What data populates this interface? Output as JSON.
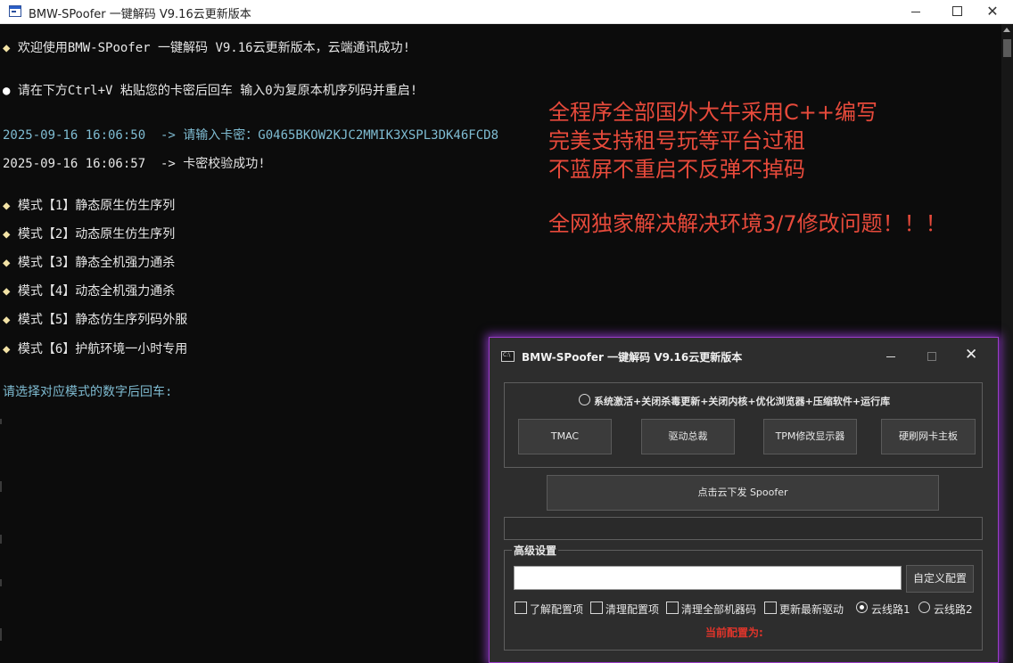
{
  "window": {
    "title": "BMW-SPoofer 一键解码 V9.16云更新版本"
  },
  "console": {
    "lines": [
      {
        "bullet": "◆",
        "text": " 欢迎使用BMW-SPoofer 一键解码 V9.16云更新版本，云端通讯成功!"
      },
      {
        "bullet": "●",
        "text": " 请在下方Ctrl+V 粘贴您的卡密后回车 输入0为复原本机序列码并重启!"
      },
      {
        "text": "2025-09-16 16:06:50  -> 请输入卡密：G0465BKOW2KJC2MMIK3XSPL3DK46FCD8"
      },
      {
        "text": "2025-09-16 16:06:57  -> 卡密校验成功!"
      },
      {
        "bullet": "◆",
        "text": " 模式【1】静态原生仿生序列"
      },
      {
        "bullet": "◆",
        "text": " 模式【2】动态原生仿生序列"
      },
      {
        "bullet": "◆",
        "text": " 模式【3】静态全机强力通杀"
      },
      {
        "bullet": "◆",
        "text": " 模式【4】动态全机强力通杀"
      },
      {
        "bullet": "◆",
        "text": " 模式【5】静态仿生序列码外服"
      },
      {
        "bullet": "◆",
        "text": " 模式【6】护航环境一小时专用"
      },
      {
        "text": "请选择对应模式的数字后回车:"
      }
    ],
    "ad_lines": [
      "全程序全部国外大牛采用C++编写",
      "完美支持租号玩等平台过租",
      "不蓝屏不重启不反弹不掉码",
      "全网独家解决解决环境3/7修改问题！！！"
    ],
    "colors": {
      "text": "#e6e6e6",
      "teal": "#7fbcd2",
      "ad": "#e74a3b",
      "bg": "#0c0c0c"
    }
  },
  "dialog": {
    "title": "BMW-SPoofer 一键解码 V9.16云更新版本",
    "top_option_label": "系统激活+关闭杀毒更新+关闭内核+优化浏览器+压缩软件+运行库",
    "buttons": [
      "TMAC",
      "驱动总裁",
      "TPM修改显示器",
      "硬刷网卡主板"
    ],
    "spoof_button": "点击云下发 Spoofer",
    "advanced": {
      "group_title": "高级设置",
      "config_input_value": "",
      "custom_config_button": "自定义配置",
      "checkboxes": [
        "了解配置项",
        "清理配置项",
        "清理全部机器码",
        "更新最新驱动"
      ],
      "radios": [
        {
          "label": "云线路1",
          "selected": true
        },
        {
          "label": "云线路2",
          "selected": false
        }
      ],
      "status_text": "当前配置为:"
    },
    "colors": {
      "border_glow": "#9b3cc9",
      "status": "#e0352b",
      "bg": "#2d2d2d"
    }
  }
}
